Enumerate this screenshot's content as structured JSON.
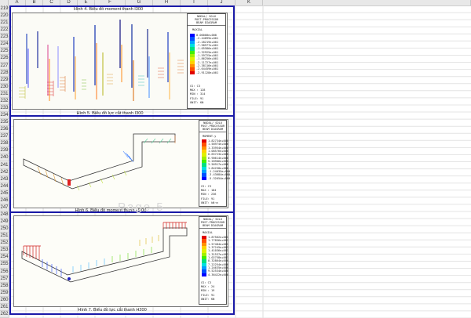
{
  "sheet": {
    "columns": [
      "A",
      "B",
      "C",
      "D",
      "E",
      "F",
      "G",
      "H",
      "I",
      "J",
      "K"
    ],
    "rows": [
      "219",
      "220",
      "221",
      "222",
      "223",
      "224",
      "225",
      "226",
      "227",
      "228",
      "229",
      "230",
      "231",
      "232",
      "233",
      "234",
      "235",
      "236",
      "237",
      "238",
      "239",
      "240",
      "241",
      "242",
      "243",
      "244",
      "245",
      "246",
      "247",
      "248",
      "249",
      "250",
      "251",
      "252",
      "253",
      "254",
      "255",
      "256",
      "257",
      "258",
      "259",
      "260",
      "261",
      "262"
    ]
  },
  "captions": {
    "fig4": "Hình 4. Biểu đồ moment thanh I300",
    "fig5": "Hình 5. Biểu đồ lực cắt thanh I300",
    "fig6": "Hình 6. Biểu đồ moment thanh H200",
    "fig7": "Hình 7. Biểu đồ lực cắt thanh H200"
  },
  "watermark": "Page 5",
  "legend1": {
    "header": [
      "NODAL/ SOLU",
      "POST-PROCESSOR",
      "BEAM DIAGRAM"
    ],
    "component": "MAXIAL",
    "values": [
      "0.00000e+000",
      "-2.44899e+001",
      "-2.28219e+001",
      "-7.98977e+001",
      "-1.05586e+001",
      "-1.32925e+001",
      "-1.59725e+001",
      "-1.86256e+001",
      "-2.11727e+001",
      "-2.38116e+001",
      "-2.64459e+001",
      "-2.91128e+001"
    ],
    "colors": [
      "#0000ff",
      "#0050ff",
      "#00a0ff",
      "#00e0e0",
      "#00e080",
      "#40f000",
      "#a0f000",
      "#e0f000",
      "#ffd000",
      "#ff9000",
      "#ff5000",
      "#e00000"
    ],
    "info": [
      "CS: C3",
      "MAX : 128",
      "MIN : 314",
      "FILE: 91",
      "UNIT: KN"
    ]
  },
  "legend2": {
    "header": [
      "NODAL/ SOLU",
      "POST-PROCESSOR",
      "BEAM DIAGRAM"
    ],
    "component": "MOMENT-y",
    "values": [
      "1.82734e+000",
      "1.58974e+000",
      "1.33954e+000",
      "1.08576e+000",
      "8.65723e+000",
      "6.90614e+000",
      "5.28906e+000",
      "3.56917e+000",
      "1.84258e+000",
      "-1.24035e+000",
      "-3.43684e+000",
      "-5.32654e+000"
    ],
    "colors": [
      "#e00000",
      "#ff5000",
      "#ff9000",
      "#ffd000",
      "#e0f000",
      "#a0f000",
      "#40f000",
      "#00e080",
      "#00e0e0",
      "#00a0ff",
      "#0050ff",
      "#0000ff"
    ],
    "info": [
      "CS: C3",
      "MAX : 184",
      "MIN : 236",
      "FILE: 91",
      "UNIT: kN·m"
    ]
  },
  "legend3": {
    "header": [
      "NODAL/ SOLU",
      "POST-PROCESSOR",
      "BEAM DIAGRAM"
    ],
    "component": "MAXIAL",
    "values": [
      "1.87562e+001",
      "1.77856e+001",
      "1.57484e+001",
      "1.37245e+001",
      "1.41036e+001",
      "1.31537e+001",
      "1.02758e+001",
      "8.32864e+000",
      "7.22254e+000",
      "1.24635e+000",
      "9.52534e+000",
      "4.36422e+000"
    ],
    "colors": [
      "#e00000",
      "#ff5000",
      "#ff9000",
      "#ffd000",
      "#e0f000",
      "#a0f000",
      "#40f000",
      "#00e080",
      "#00e0e0",
      "#00a0ff",
      "#0050ff",
      "#0000ff"
    ],
    "info": [
      "CS: C3",
      "MAX : 24",
      "MIN : 19",
      "FILE: 91",
      "UNIT: KN"
    ]
  }
}
